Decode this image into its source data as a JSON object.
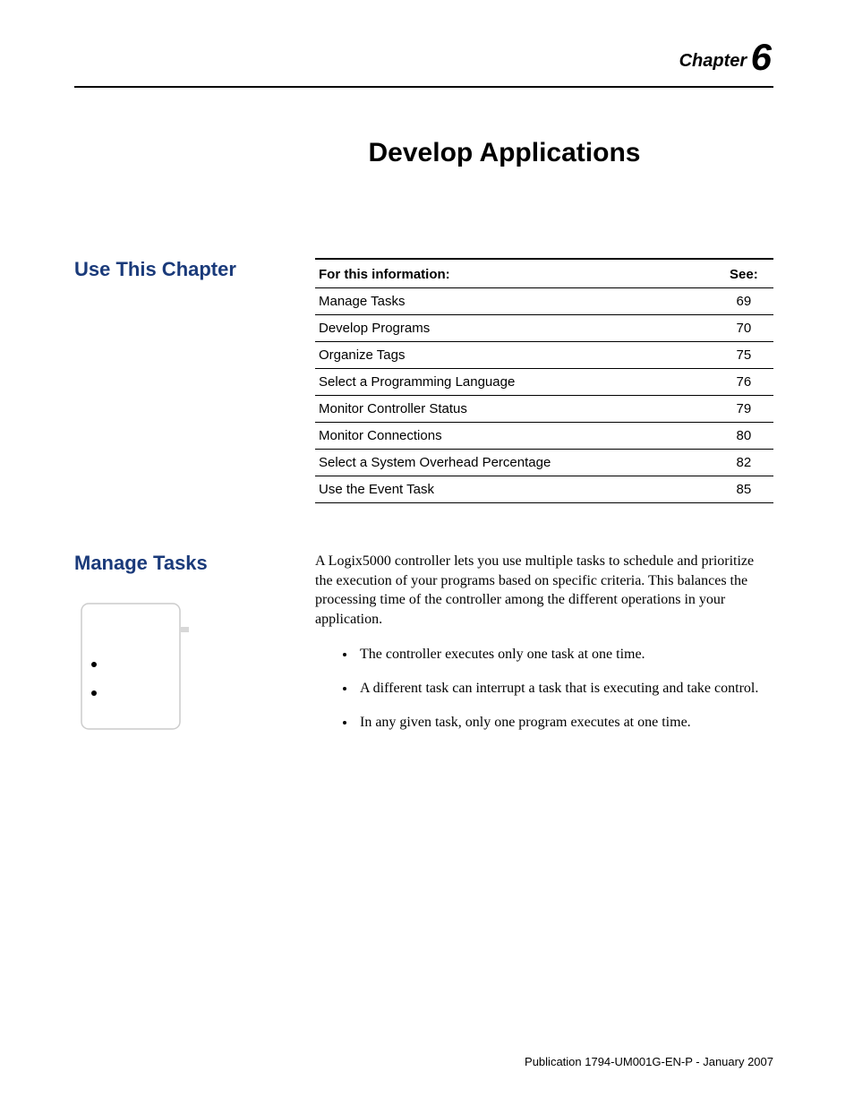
{
  "chapter": {
    "label": "Chapter",
    "number": "6"
  },
  "page_title": "Develop Applications",
  "sections": {
    "use_this_chapter": {
      "heading": "Use This Chapter",
      "table_headers": {
        "info": "For this information:",
        "see": "See:"
      },
      "rows": [
        {
          "info": "Manage Tasks",
          "see": "69"
        },
        {
          "info": "Develop Programs",
          "see": "70"
        },
        {
          "info": "Organize Tags",
          "see": "75"
        },
        {
          "info": "Select a Programming Language",
          "see": "76"
        },
        {
          "info": "Monitor Controller Status",
          "see": "79"
        },
        {
          "info": "Monitor Connections",
          "see": "80"
        },
        {
          "info": "Select a System Overhead Percentage",
          "see": "82"
        },
        {
          "info": "Use the Event Task",
          "see": "85"
        }
      ]
    },
    "manage_tasks": {
      "heading": "Manage Tasks",
      "intro": "A Logix5000 controller lets you use multiple tasks to schedule and prioritize the execution of your programs based on specific criteria. This balances the processing time of the controller among the different operations in your application.",
      "bullets": [
        "The controller executes only one task at one time.",
        "A different task can interrupt a task that is executing and take control.",
        "In any given task, only one program executes at one time."
      ]
    }
  },
  "footer": "Publication 1794-UM001G-EN-P - January 2007"
}
